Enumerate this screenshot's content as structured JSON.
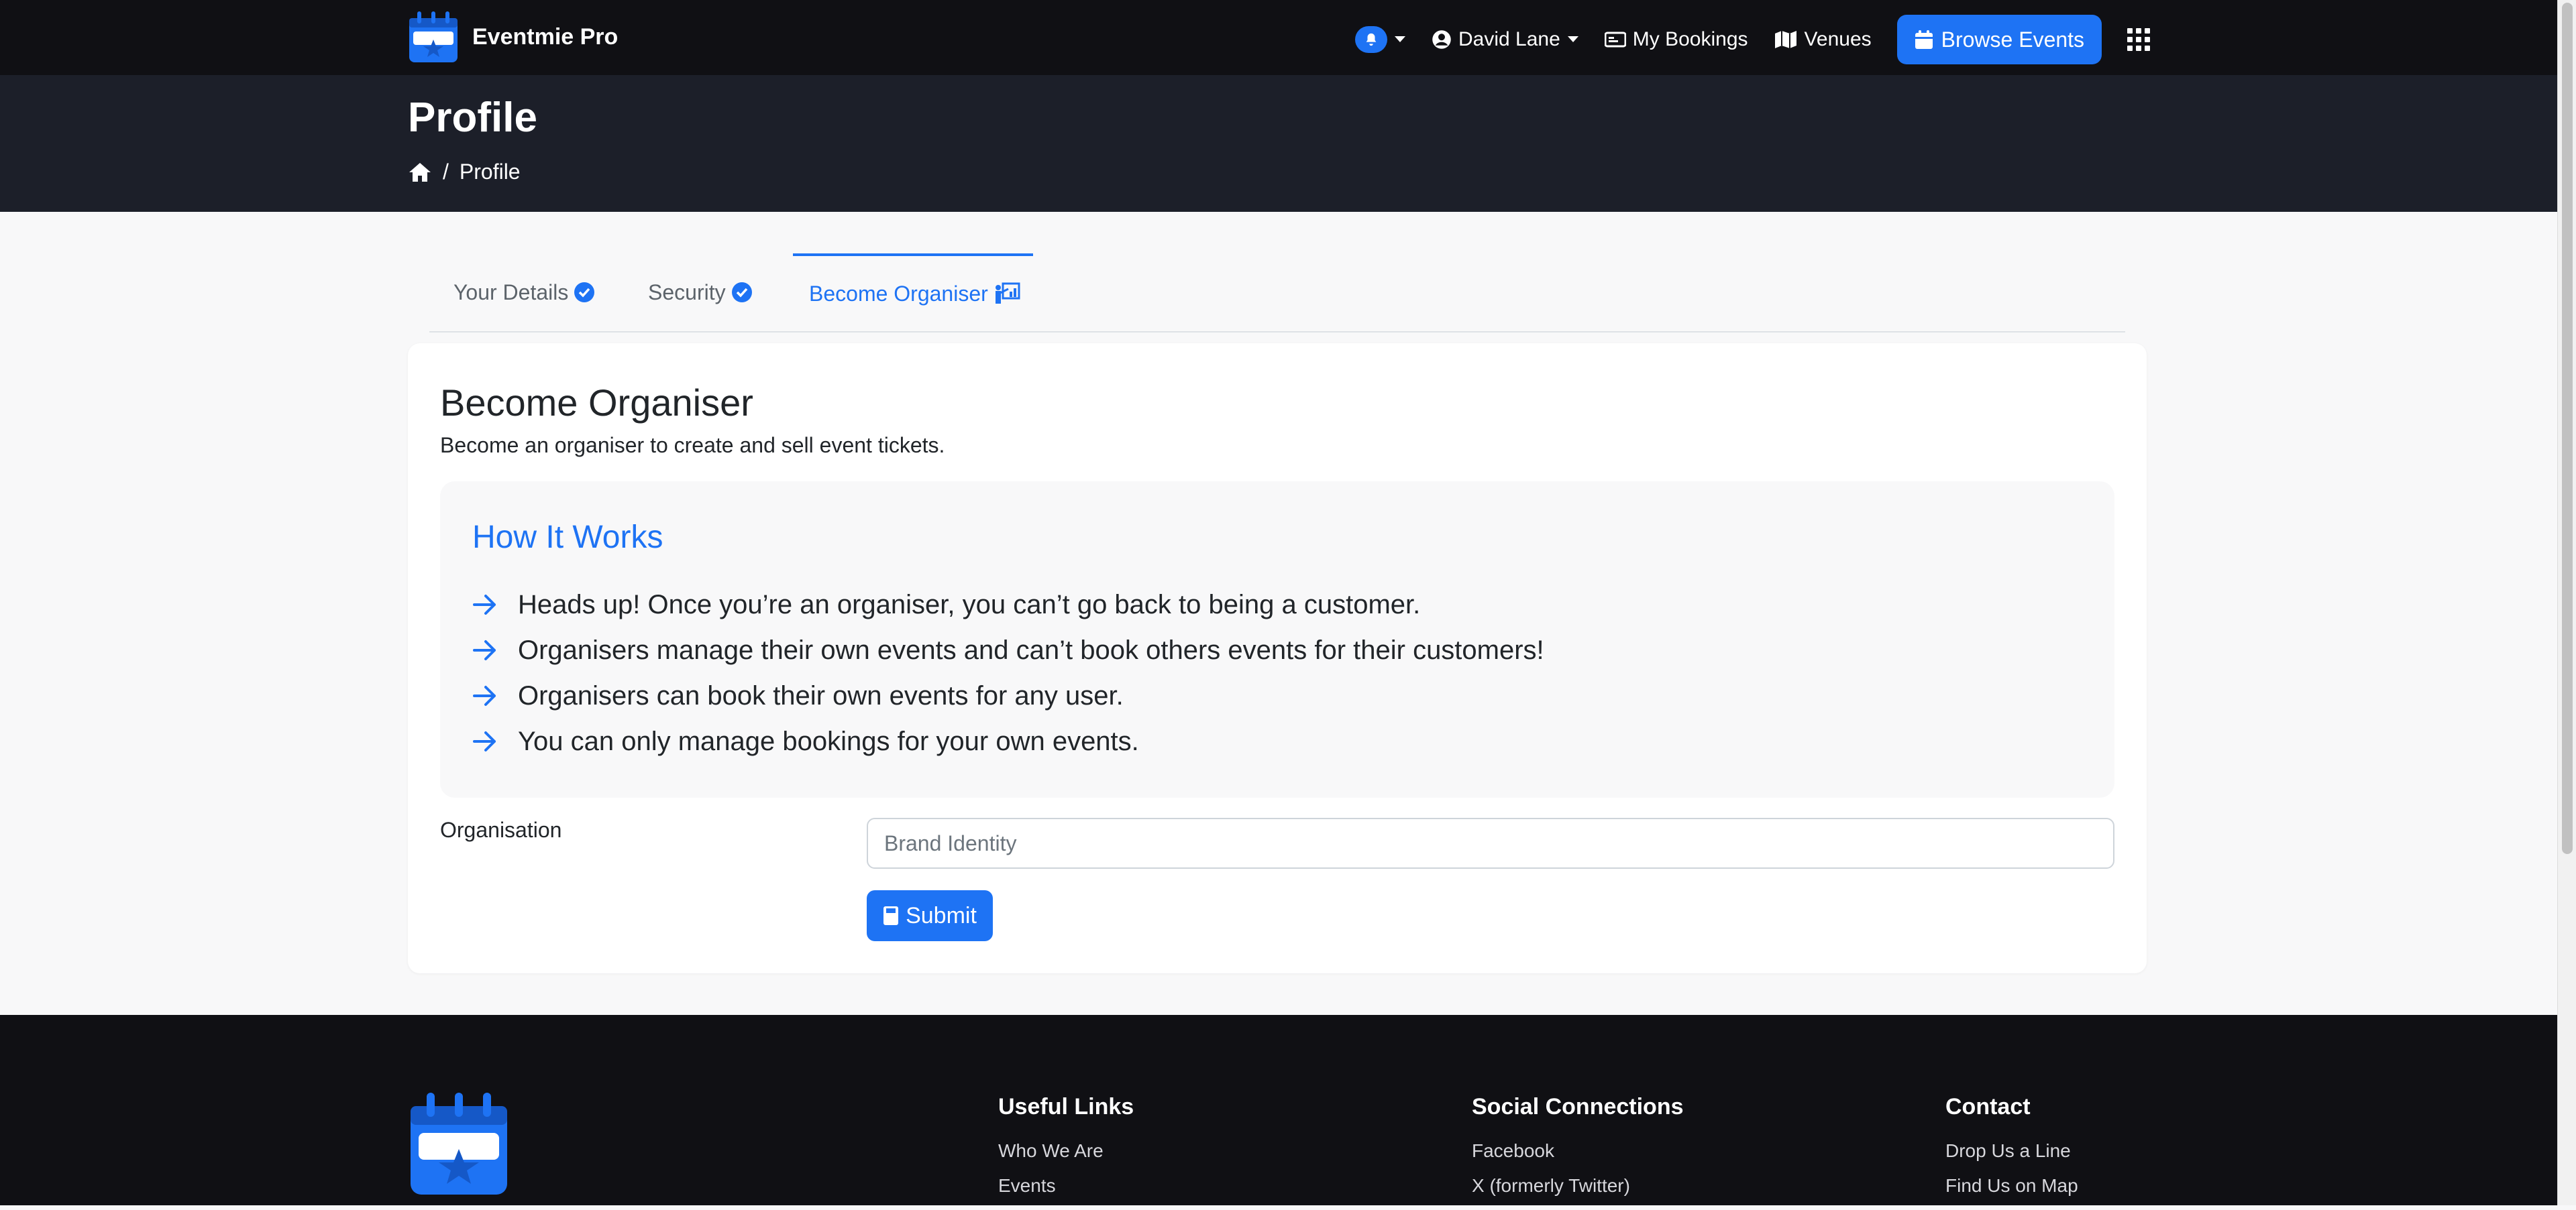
{
  "header": {
    "brand": "Eventmie Pro",
    "user_name": "David Lane",
    "nav": {
      "my_bookings": "My Bookings",
      "venues": "Venues",
      "browse_events": "Browse Events"
    }
  },
  "hero": {
    "title": "Profile",
    "breadcrumb_current": "Profile"
  },
  "tabs": [
    {
      "label": "Your Details"
    },
    {
      "label": "Security"
    },
    {
      "label": "Become Organiser"
    }
  ],
  "card": {
    "title": "Become Organiser",
    "subtitle": "Become an organiser to create and sell event tickets.",
    "how": {
      "title": "How It Works",
      "items": [
        "Heads up! Once you’re an organiser, you can’t go back to being a customer.",
        "Organisers manage their own events and can’t book others events for their customers!",
        "Organisers can book their own events for any user.",
        "You can only manage bookings for your own events."
      ]
    },
    "form": {
      "org_label": "Organisation",
      "org_placeholder": "Brand Identity",
      "submit": "Submit"
    }
  },
  "footer": {
    "useful_links": {
      "title": "Useful Links",
      "links": [
        "Who We Are",
        "Events"
      ]
    },
    "social": {
      "title": "Social Connections",
      "links": [
        "Facebook",
        "X (formerly Twitter)"
      ]
    },
    "contact": {
      "title": "Contact",
      "links": [
        "Drop Us a Line",
        "Find Us on Map"
      ]
    }
  },
  "colors": {
    "accent": "#1e73f4",
    "nav_bg": "#101014",
    "hero_bg": "#1c1f29"
  }
}
